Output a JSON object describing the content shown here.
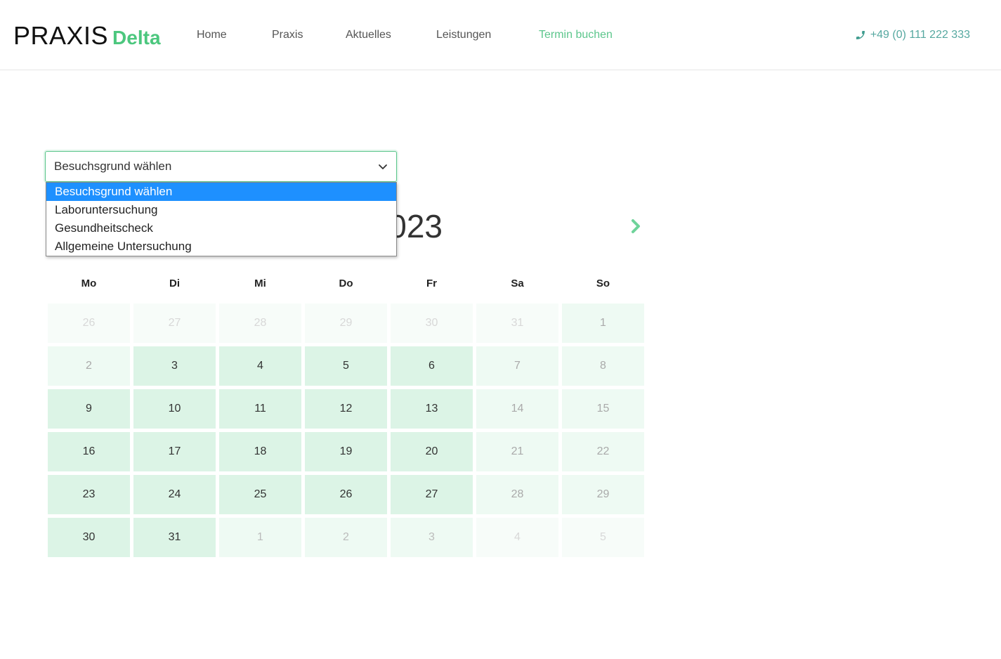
{
  "header": {
    "logo_main": "PRAXIS",
    "logo_accent": "Delta",
    "nav": [
      {
        "label": "Home"
      },
      {
        "label": "Praxis"
      },
      {
        "label": "Aktuelles"
      },
      {
        "label": "Leistungen"
      },
      {
        "label": "Termin buchen",
        "active": true
      }
    ],
    "phone": "+49 (0) 111 222 333",
    "phone_icon": "phone-icon"
  },
  "select": {
    "value": "Besuchsgrund wählen",
    "options": [
      {
        "label": "Besuchsgrund wählen",
        "selected": true
      },
      {
        "label": "Laboruntersuchung"
      },
      {
        "label": "Gesundheitscheck"
      },
      {
        "label": "Allgemeine Untersuchung"
      }
    ]
  },
  "calendar": {
    "month_title_visible": "023",
    "weekdays": [
      "Mo",
      "Di",
      "Mi",
      "Do",
      "Fr",
      "Sa",
      "So"
    ],
    "days": [
      {
        "d": "26",
        "s": "outside"
      },
      {
        "d": "27",
        "s": "outside"
      },
      {
        "d": "28",
        "s": "outside"
      },
      {
        "d": "29",
        "s": "outside"
      },
      {
        "d": "30",
        "s": "outside"
      },
      {
        "d": "31",
        "s": "outside"
      },
      {
        "d": "1",
        "s": "weekend"
      },
      {
        "d": "2",
        "s": "weekend"
      },
      {
        "d": "3",
        "s": "available"
      },
      {
        "d": "4",
        "s": "available"
      },
      {
        "d": "5",
        "s": "available"
      },
      {
        "d": "6",
        "s": "available"
      },
      {
        "d": "7",
        "s": "weekend"
      },
      {
        "d": "8",
        "s": "weekend"
      },
      {
        "d": "9",
        "s": "available"
      },
      {
        "d": "10",
        "s": "available"
      },
      {
        "d": "11",
        "s": "available"
      },
      {
        "d": "12",
        "s": "available"
      },
      {
        "d": "13",
        "s": "available"
      },
      {
        "d": "14",
        "s": "weekend"
      },
      {
        "d": "15",
        "s": "weekend"
      },
      {
        "d": "16",
        "s": "available"
      },
      {
        "d": "17",
        "s": "available"
      },
      {
        "d": "18",
        "s": "available"
      },
      {
        "d": "19",
        "s": "available"
      },
      {
        "d": "20",
        "s": "available"
      },
      {
        "d": "21",
        "s": "weekend"
      },
      {
        "d": "22",
        "s": "weekend"
      },
      {
        "d": "23",
        "s": "available"
      },
      {
        "d": "24",
        "s": "available"
      },
      {
        "d": "25",
        "s": "available"
      },
      {
        "d": "26",
        "s": "available"
      },
      {
        "d": "27",
        "s": "available"
      },
      {
        "d": "28",
        "s": "weekend"
      },
      {
        "d": "29",
        "s": "weekend"
      },
      {
        "d": "30",
        "s": "available"
      },
      {
        "d": "31",
        "s": "available"
      },
      {
        "d": "1",
        "s": "outside-light"
      },
      {
        "d": "2",
        "s": "outside-light"
      },
      {
        "d": "3",
        "s": "outside-light"
      },
      {
        "d": "4",
        "s": "outside"
      },
      {
        "d": "5",
        "s": "outside"
      }
    ],
    "next_icon": "chevron-right-icon"
  },
  "colors": {
    "accent": "#4cc77e",
    "available": "#dcf4e6",
    "weekend": "#eefaf3",
    "selected_option": "#1e90ff",
    "phone": "#56a8a0"
  }
}
